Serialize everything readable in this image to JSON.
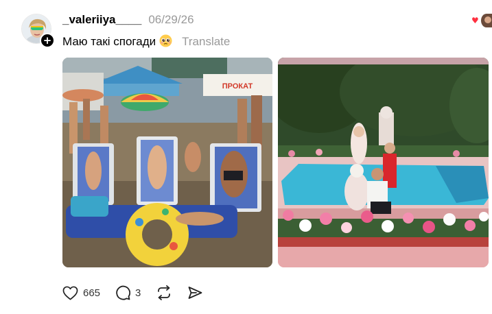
{
  "post": {
    "username": "_valeriiya____",
    "timestamp": "06/29/26",
    "caption": "Маю такі спогади",
    "caption_emoji": "pleading-face-emoji",
    "translate_label": "Translate"
  },
  "photos": [
    {
      "name": "beach-photo",
      "sign_text": "ПРОКАТ"
    },
    {
      "name": "pool-photo"
    }
  ],
  "actions": {
    "like_count": "665",
    "reply_count": "3"
  },
  "icons": {
    "like": "heart-icon",
    "reply": "comment-icon",
    "repost": "repost-icon",
    "share": "send-icon",
    "follow": "plus-icon"
  },
  "colors": {
    "accent_heart": "#ff3040",
    "muted_text": "#999999",
    "pool_water": "#3ab7d6"
  }
}
